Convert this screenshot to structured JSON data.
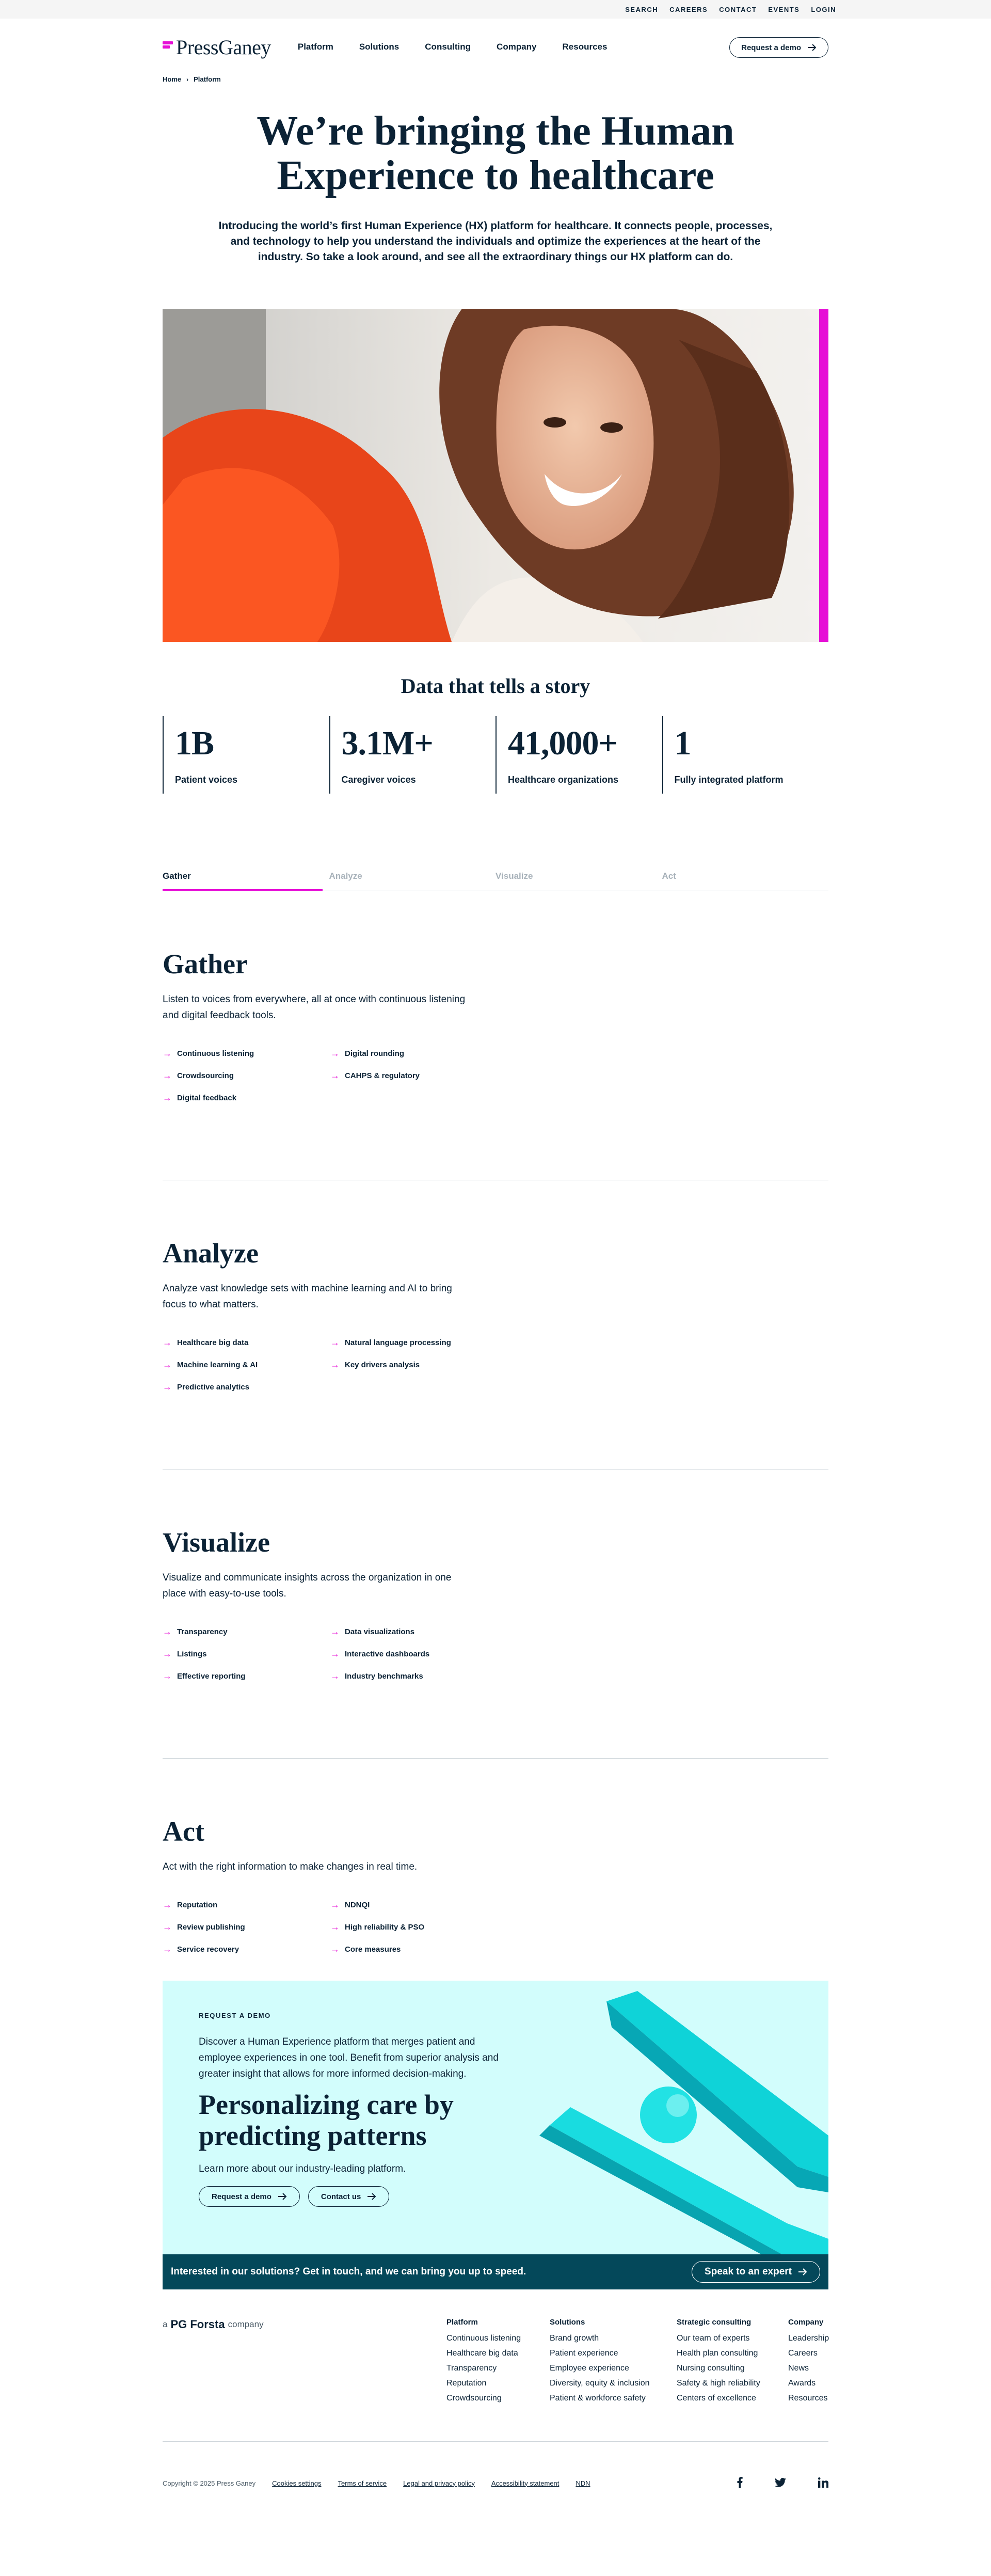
{
  "utility_nav": [
    "SEARCH",
    "CAREERS",
    "CONTACT",
    "EVENTS",
    "LOGIN"
  ],
  "header": {
    "logo_text": "PressGaney",
    "nav": [
      "Platform",
      "Solutions",
      "Consulting",
      "Company",
      "Resources"
    ],
    "cta_label": "Request a demo"
  },
  "breadcrumb": {
    "home": "Home",
    "current": "Platform"
  },
  "hero": {
    "title_line1": "We’re bringing the Human",
    "title_line2": "Experience to healthcare",
    "intro": "Introducing the world’s first Human Experience (HX) platform for healthcare. It connects people, processes, and technology to help you understand the individuals and optimize the experiences at the heart of the industry. So take a look around, and see all the extraordinary things our HX platform can do."
  },
  "stats": {
    "title": "Data that tells a story",
    "items": [
      {
        "value": "1B",
        "label": "Patient voices"
      },
      {
        "value": "3.1M+",
        "label": "Caregiver voices"
      },
      {
        "value": "41,000+",
        "label": "Healthcare organizations"
      },
      {
        "value": "1",
        "label": "Fully integrated platform"
      }
    ]
  },
  "tabs": [
    "Gather",
    "Analyze",
    "Visualize",
    "Act"
  ],
  "sections": [
    {
      "title": "Gather",
      "desc": "Listen to voices from everywhere, all at once with continuous listening and digital feedback tools.",
      "features": [
        "Continuous listening",
        "Digital rounding",
        "Crowdsourcing",
        "CAHPS & regulatory",
        "Digital feedback"
      ]
    },
    {
      "title": "Analyze",
      "desc": "Analyze vast knowledge sets with machine learning and AI to bring focus to what matters.",
      "features": [
        "Healthcare big data",
        "Natural language processing",
        "Machine learning & AI",
        "Key drivers analysis",
        "Predictive analytics"
      ]
    },
    {
      "title": "Visualize",
      "desc": "Visualize and communicate insights across the organization in one place with easy-to-use tools.",
      "features": [
        "Transparency",
        "Data visualizations",
        "Listings",
        "Interactive dashboards",
        "Effective reporting",
        "Industry benchmarks"
      ]
    },
    {
      "title": "Act",
      "desc": "Act with the right information to make changes in real time.",
      "features": [
        "Reputation",
        "NDNQI",
        "Review publishing",
        "High reliability & PSO",
        "Service recovery",
        "Core measures"
      ]
    }
  ],
  "cta": {
    "kicker": "REQUEST A DEMO",
    "lead": "Discover a Human Experience platform that merges patient and employee experiences in one tool. Benefit from superior analysis and greater insight that allows for more informed decision-making.",
    "title": "Personalizing care by predicting patterns",
    "sub": "Learn more about our industry-leading platform.",
    "btn1": "Request a demo",
    "btn2": "Contact us"
  },
  "contact_bar": {
    "text": "Interested in our solutions? Get in touch, and we can bring you up to speed.",
    "button": "Speak to an expert"
  },
  "footer": {
    "brand_prefix": "a",
    "brand_name": "PG Forsta",
    "brand_suffix": "company",
    "columns": [
      {
        "title": "Platform",
        "links": [
          "Continuous listening",
          "Healthcare big data",
          "Transparency",
          "Reputation",
          "Crowdsourcing"
        ]
      },
      {
        "title": "Solutions",
        "links": [
          "Brand growth",
          "Patient experience",
          "Employee experience",
          "Diversity, equity & inclusion",
          "Patient & workforce safety"
        ]
      },
      {
        "title": "Strategic consulting",
        "links": [
          "Our team of experts",
          "Health plan consulting",
          "Nursing consulting",
          "Safety & high reliability",
          "Centers of excellence"
        ]
      },
      {
        "title": "Company",
        "links": [
          "Leadership",
          "Careers",
          "News",
          "Awards",
          "Resources"
        ]
      }
    ],
    "copyright": "Copyright © 2025 Press Ganey",
    "legal": [
      "Cookies settings",
      "Terms of service",
      "Legal and privacy policy",
      "Accessibility statement",
      "NDN"
    ]
  },
  "colors": {
    "accent": "#e60fd6",
    "navy": "#0b2235",
    "cta_bg": "#d2fdfc",
    "contact_bar": "#04485a"
  }
}
